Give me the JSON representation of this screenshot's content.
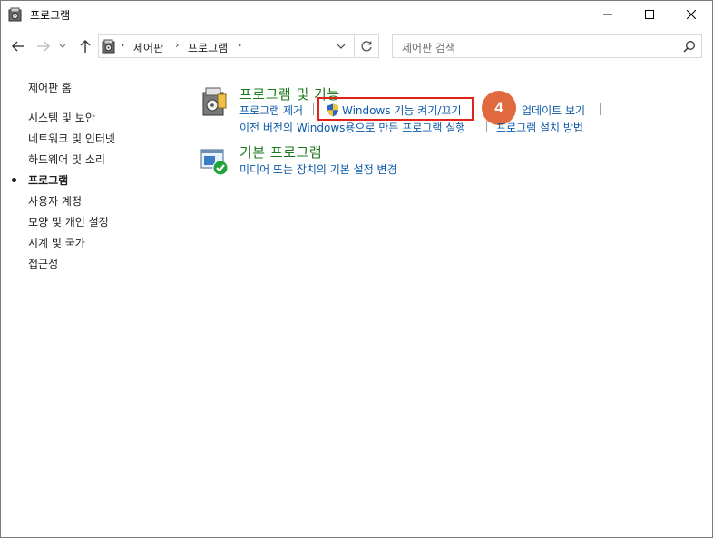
{
  "window": {
    "title": "프로그램"
  },
  "address": {
    "crumbs": [
      "제어판",
      "프로그램"
    ]
  },
  "search": {
    "placeholder": "제어판 검색"
  },
  "sidebar": {
    "home": "제어판 홈",
    "items": [
      {
        "label": "시스템 및 보안",
        "active": false
      },
      {
        "label": "네트워크 및 인터넷",
        "active": false
      },
      {
        "label": "하드웨어 및 소리",
        "active": false
      },
      {
        "label": "프로그램",
        "active": true
      },
      {
        "label": "사용자 계정",
        "active": false
      },
      {
        "label": "모양 및 개인 설정",
        "active": false
      },
      {
        "label": "시계 및 국가",
        "active": false
      },
      {
        "label": "접근성",
        "active": false
      }
    ]
  },
  "main": {
    "programs_features": {
      "title": "프로그램 및 기능",
      "links": {
        "uninstall": "프로그램 제거",
        "windows_features": "Windows 기능 켜기/끄기",
        "view_updates": "업데이트 보기",
        "compat": "이전 버전의 Windows용으로 만든 프로그램 실행",
        "how_install": "프로그램 설치 방법"
      }
    },
    "default_programs": {
      "title": "기본 프로그램",
      "links": {
        "media_defaults": "미디어 또는 장치의 기본 설정 변경"
      }
    }
  },
  "annotation": {
    "step_number": "4",
    "badge_color": "#e06a3d",
    "highlight_color": "#e2231a"
  },
  "colors": {
    "link": "#0c59a8",
    "category_title": "#1e7a1e"
  }
}
